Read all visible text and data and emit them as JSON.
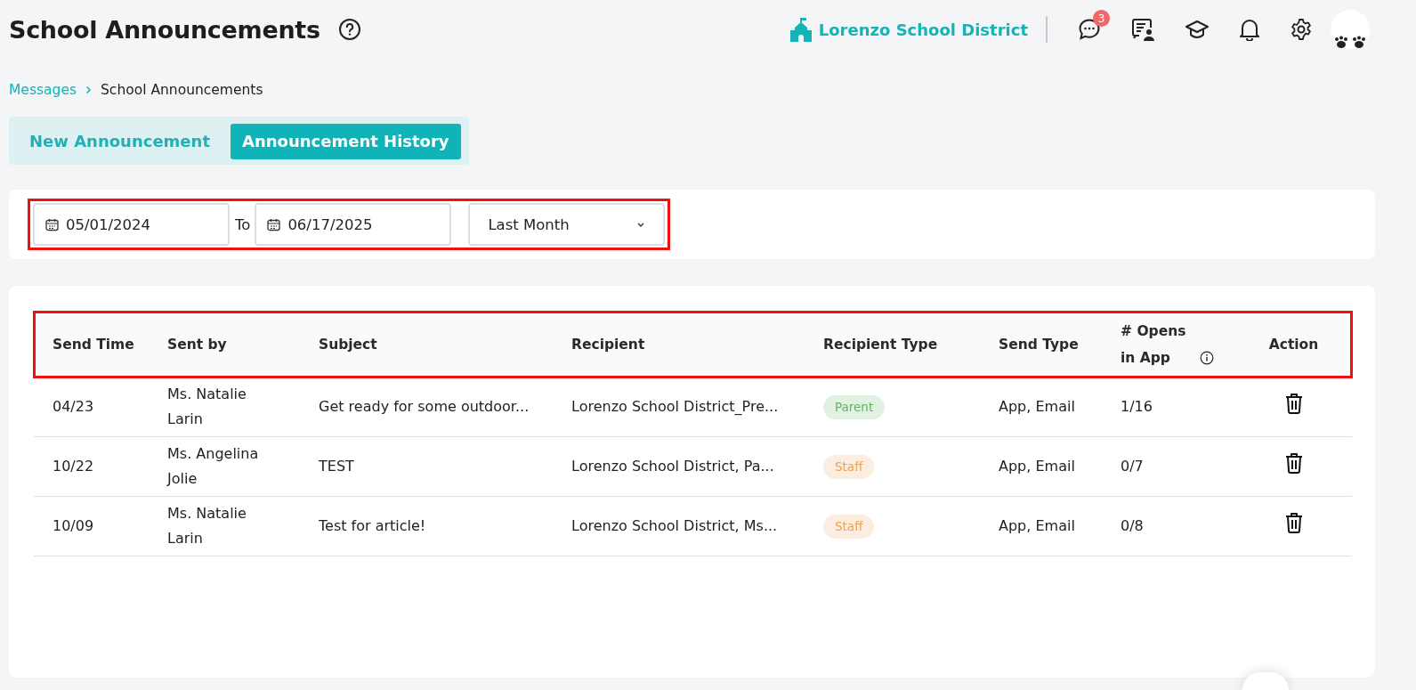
{
  "header": {
    "title": "School Announcements",
    "district": "Lorenzo School District",
    "notification_count": "3"
  },
  "breadcrumb": [
    "Messages",
    "School Announcements"
  ],
  "tabs": [
    {
      "label": "New Announcement",
      "selected": false
    },
    {
      "label": "Announcement History",
      "selected": true
    }
  ],
  "filters": {
    "highlighted": true,
    "from_date": "05/01/2024",
    "separator": "To",
    "to_date": "06/17/2025",
    "range": "Last Month"
  },
  "table": {
    "header_highlighted": true,
    "columns": [
      "Send Time",
      "Sent by",
      "Subject",
      "Recipient",
      "Recipient Type",
      "Send Type",
      "# Opens in App",
      "Action"
    ],
    "rows": [
      {
        "send_time": "04/23",
        "sent_by": "Ms. Natalie Larin",
        "subject": "Get ready for some outdoor...",
        "recipient": "Lorenzo School District_Pre...",
        "recipient_type": {
          "label": "Parent",
          "color": "#5cb85c"
        },
        "send_type": "App, Email",
        "opens": "1/16"
      },
      {
        "send_time": "10/22",
        "sent_by": "Ms. Angelina Jolie",
        "subject": "TEST",
        "recipient": "Lorenzo School District, Pa...",
        "recipient_type": {
          "label": "Staff",
          "color": "#e8a255"
        },
        "send_type": "App, Email",
        "opens": "0/7"
      },
      {
        "send_time": "10/09",
        "sent_by": "Ms. Natalie Larin",
        "subject": "Test for article!",
        "recipient": "Lorenzo School District, Ms...",
        "recipient_type": {
          "label": "Staff",
          "color": "#e8a255"
        },
        "send_type": "App, Email",
        "opens": "0/8"
      }
    ]
  }
}
